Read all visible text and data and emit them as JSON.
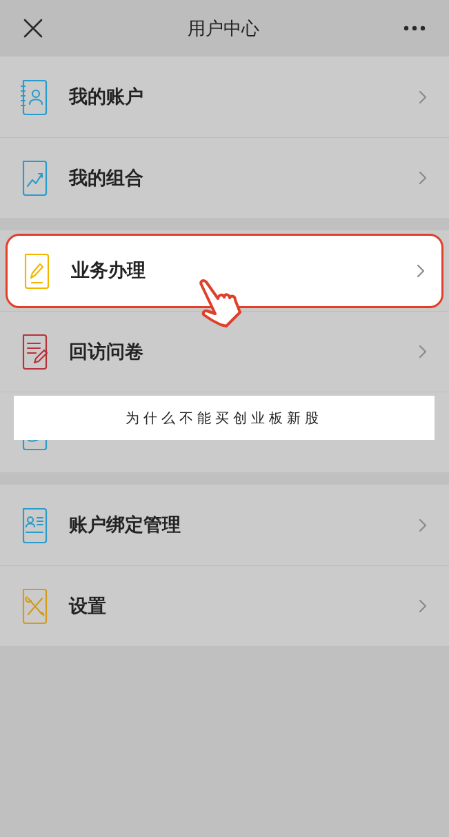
{
  "header": {
    "title": "用户中心"
  },
  "groups": [
    {
      "items": [
        {
          "label": "我的账户",
          "highlighted": false
        },
        {
          "label": "我的组合",
          "highlighted": false
        }
      ]
    },
    {
      "items": [
        {
          "label": "业务办理",
          "highlighted": true
        },
        {
          "label": "回访问卷",
          "highlighted": false
        },
        {
          "highlighted": false
        }
      ]
    },
    {
      "items": [
        {
          "label": "账户绑定管理",
          "highlighted": false
        },
        {
          "label": "设置",
          "highlighted": false
        }
      ]
    }
  ],
  "caption": "为什么不能买创业板新股"
}
